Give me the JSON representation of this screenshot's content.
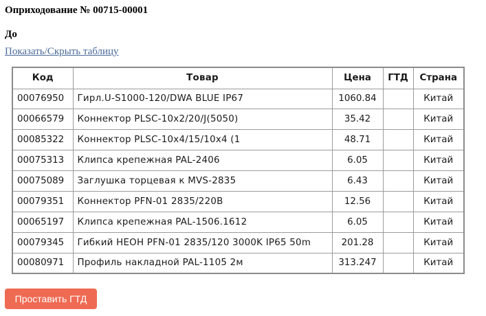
{
  "document": {
    "title": "Оприходование № 00715-00001",
    "destination_label": "До"
  },
  "toggle_link": "Показать/Скрыть таблицу",
  "table": {
    "headers": {
      "code": "Код",
      "name": "Товар",
      "price": "Цена",
      "gtd": "ГТД",
      "country": "Страна"
    },
    "rows": [
      {
        "code": "00076950",
        "name": "Гирл.U-S1000-120/DWA BLUE IP67",
        "price": "1060.84",
        "gtd": "",
        "country": "Китай"
      },
      {
        "code": "00066579",
        "name": "Коннектор PLSC-10x2/20/J(5050)",
        "price": "35.42",
        "gtd": "",
        "country": "Китай"
      },
      {
        "code": "00085322",
        "name": "Коннектор PLSC-10x4/15/10x4 (1",
        "price": "48.71",
        "gtd": "",
        "country": "Китай"
      },
      {
        "code": "00075313",
        "name": "Клипса крепежная PAL-2406",
        "price": "6.05",
        "gtd": "",
        "country": "Китай"
      },
      {
        "code": "00075089",
        "name": "Заглушка торцевая к MVS-2835",
        "price": "6.43",
        "gtd": "",
        "country": "Китай"
      },
      {
        "code": "00079351",
        "name": "Коннектор PFN-01 2835/220B",
        "price": "12.56",
        "gtd": "",
        "country": "Китай"
      },
      {
        "code": "00065197",
        "name": "Клипса крепежная PAL-1506.1612",
        "price": "6.05",
        "gtd": "",
        "country": "Китай"
      },
      {
        "code": "00079345",
        "name": "Гибкий НЕОН PFN-01 2835/120 3000K IP65 50m",
        "price": "201.28",
        "gtd": "",
        "country": "Китай"
      },
      {
        "code": "00080971",
        "name": "Профиль накладной PAL-1105 2м",
        "price": "313.247",
        "gtd": "",
        "country": "Китай"
      }
    ]
  },
  "actions": {
    "set_gtd_label": "Проставить ГТД"
  },
  "colors": {
    "button_bg": "#ef6a52",
    "link": "#4a6a99",
    "table_border": "#8a8a8a"
  }
}
